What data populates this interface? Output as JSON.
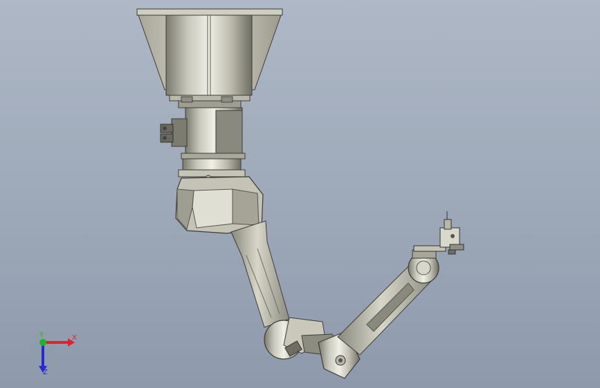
{
  "viewport": {
    "background_top": "#aeb8c6",
    "background_bottom": "#8e9aac"
  },
  "model": {
    "name": "",
    "parts": [
      {
        "name": "mounting-flange",
        "icon": "flange-icon"
      },
      {
        "name": "base-housing",
        "icon": "housing-icon"
      },
      {
        "name": "motor-connector-block",
        "icon": "connector-icon"
      },
      {
        "name": "shoulder-joint",
        "icon": "joint-icon"
      },
      {
        "name": "upper-arm",
        "icon": "link-icon"
      },
      {
        "name": "elbow-joint",
        "icon": "joint-icon"
      },
      {
        "name": "forearm",
        "icon": "link-icon"
      },
      {
        "name": "wrist-joint",
        "icon": "joint-icon"
      },
      {
        "name": "end-effector-tool",
        "icon": "tool-icon"
      }
    ]
  },
  "triad": {
    "x_label": "X",
    "y_label": "Y",
    "z_label": "Z",
    "x_color": "#e0202a",
    "y_color": "#22b422",
    "z_color": "#2a2ad0"
  }
}
